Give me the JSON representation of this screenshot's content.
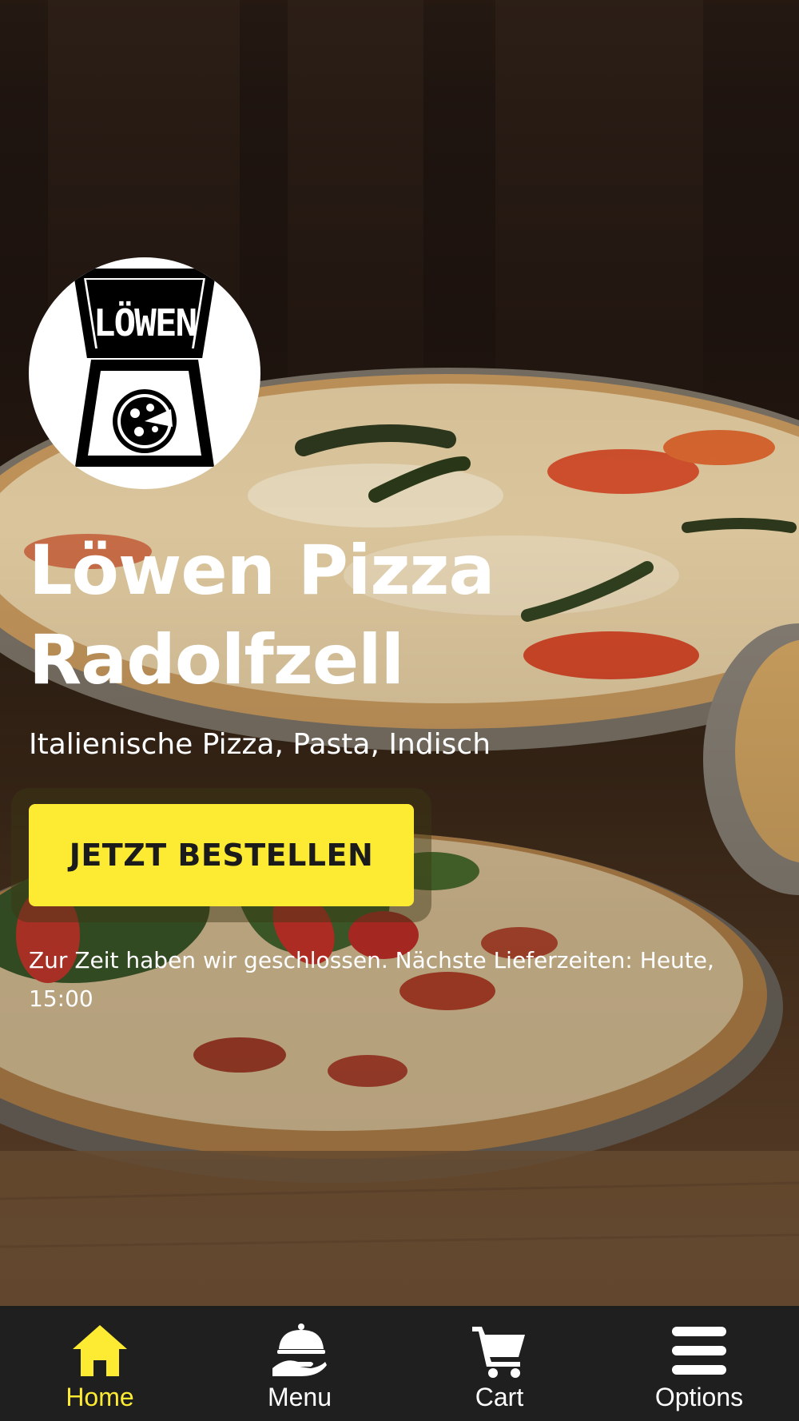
{
  "restaurant": {
    "name": "Löwen Pizza Radolfzell",
    "name_line1": "Löwen Pizza",
    "name_line2": "Radolfzell",
    "cuisine": "Italienische Pizza, Pasta, Indisch",
    "logo_text": "LÖWEN"
  },
  "hero": {
    "order_button_label": "JETZT BESTELLEN",
    "status_notice": "Zur Zeit haben wir geschlossen. Nächste Lieferzeiten: Heute, 15:00"
  },
  "bottom_nav": {
    "items": [
      {
        "label": "Home",
        "icon": "home-icon",
        "active": true
      },
      {
        "label": "Menu",
        "icon": "serving-dish-icon",
        "active": false
      },
      {
        "label": "Cart",
        "icon": "cart-icon",
        "active": false
      },
      {
        "label": "Options",
        "icon": "hamburger-menu-icon",
        "active": false
      }
    ]
  },
  "colors": {
    "accent": "#fdeb33",
    "nav_background": "#1f1f1f",
    "text": "#ffffff",
    "button_text": "#1b1b1b"
  }
}
